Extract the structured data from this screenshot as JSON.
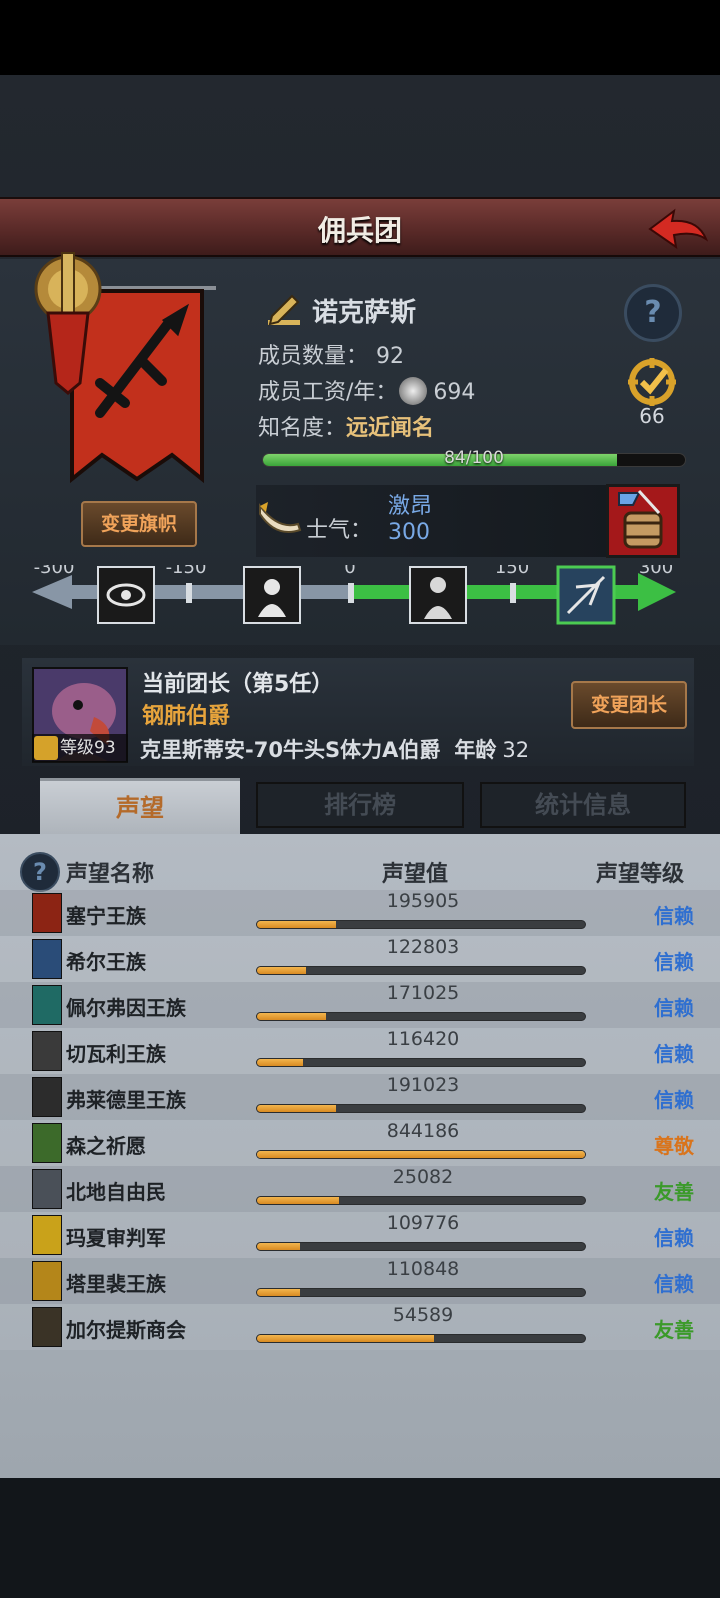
{
  "header": {
    "title": "佣兵团"
  },
  "guild": {
    "name": "诺克萨斯",
    "members_label": "成员数量：",
    "members_value": "92",
    "salary_label": "成员工资/年：",
    "salary_value": "694",
    "fame_label": "知名度：",
    "fame_value": "远近闻名",
    "fame_progress_text": "84/100",
    "fame_progress": 0.84,
    "badge_value": "66",
    "change_banner_label": "变更旗帜"
  },
  "morale": {
    "label": "士气：",
    "state": "激昂",
    "value": "300",
    "scale_ticks": [
      "-300",
      "-150",
      "0",
      "150",
      "300"
    ]
  },
  "leader": {
    "title": "当前团长（第5任）",
    "rank": "钢肺伯爵",
    "level": "等级93",
    "description": "克里斯蒂安-70牛头S体力A伯爵",
    "age_label": "年龄",
    "age_value": "32",
    "change_leader_label": "变更团长"
  },
  "tabs": [
    {
      "label": "声望",
      "active": true
    },
    {
      "label": "排行榜",
      "active": false
    },
    {
      "label": "统计信息",
      "active": false
    }
  ],
  "table": {
    "headers": {
      "name": "声望名称",
      "value": "声望值",
      "level": "声望等级"
    },
    "rows": [
      {
        "name": "塞宁王族",
        "value": "195905",
        "progress": 0.24,
        "level": "信赖",
        "level_color": "#2f6fd0",
        "icon_color": "#8c2414"
      },
      {
        "name": "希尔王族",
        "value": "122803",
        "progress": 0.15,
        "level": "信赖",
        "level_color": "#2f6fd0",
        "icon_color": "#2a4c78"
      },
      {
        "name": "佩尔弗因王族",
        "value": "171025",
        "progress": 0.21,
        "level": "信赖",
        "level_color": "#2f6fd0",
        "icon_color": "#1f6a64"
      },
      {
        "name": "切瓦利王族",
        "value": "116420",
        "progress": 0.14,
        "level": "信赖",
        "level_color": "#2f6fd0",
        "icon_color": "#3a3a3a"
      },
      {
        "name": "弗莱德里王族",
        "value": "191023",
        "progress": 0.24,
        "level": "信赖",
        "level_color": "#2f6fd0",
        "icon_color": "#2c2c2c"
      },
      {
        "name": "森之祈愿",
        "value": "844186",
        "progress": 1.0,
        "level": "尊敬",
        "level_color": "#d9741c",
        "icon_color": "#3c6a2a"
      },
      {
        "name": "北地自由民",
        "value": "25082",
        "progress": 0.25,
        "level": "友善",
        "level_color": "#3b9a2a",
        "icon_color": "#4a5058"
      },
      {
        "name": "玛夏审判军",
        "value": "109776",
        "progress": 0.13,
        "level": "信赖",
        "level_color": "#2f6fd0",
        "icon_color": "#c9a21a"
      },
      {
        "name": "塔里裴王族",
        "value": "110848",
        "progress": 0.13,
        "level": "信赖",
        "level_color": "#2f6fd0",
        "icon_color": "#b4861a"
      },
      {
        "name": "加尔提斯商会",
        "value": "54589",
        "progress": 0.54,
        "level": "友善",
        "level_color": "#3b9a2a",
        "icon_color": "#3a3326"
      }
    ]
  }
}
